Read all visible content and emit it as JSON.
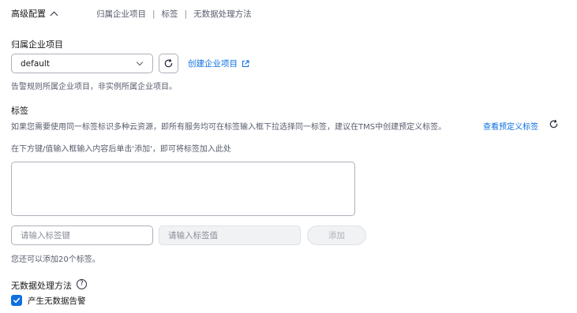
{
  "header": {
    "title": "高级配置",
    "summary": [
      "归属企业项目",
      "标签",
      "无数据处理方法"
    ],
    "separator": "|"
  },
  "enterprise_project": {
    "label": "归属企业项目",
    "selected": "default",
    "create_link": "创建企业项目",
    "hint": "告警规则所属企业项目，非实例所属企业项目。"
  },
  "tags": {
    "label": "标签",
    "description": "如果您需要使用同一标签标识多种云资源，即所有服务均可在标签输入框下拉选择同一标签，建议在TMS中创建预定义标签。",
    "view_link": "查看预定义标签",
    "instruction": "在下方键/值输入框输入内容后单击'添加'，即可将标签加入此处",
    "key_placeholder": "请输入标签键",
    "value_placeholder": "请输入标签值",
    "add_label": "添加",
    "limit_hint": "您还可以添加20个标签。"
  },
  "no_data": {
    "label": "无数据处理方法",
    "help": "?",
    "checkbox_label": "产生无数据告警",
    "checked": true
  },
  "colors": {
    "link": "#0d6fe1",
    "checkbox": "#0d6fe1",
    "border": "#adb0b8"
  },
  "icons": [
    "chevron-up-icon",
    "chevron-down-icon",
    "refresh-icon",
    "external-link-icon",
    "help-icon",
    "checkmark-icon"
  ]
}
